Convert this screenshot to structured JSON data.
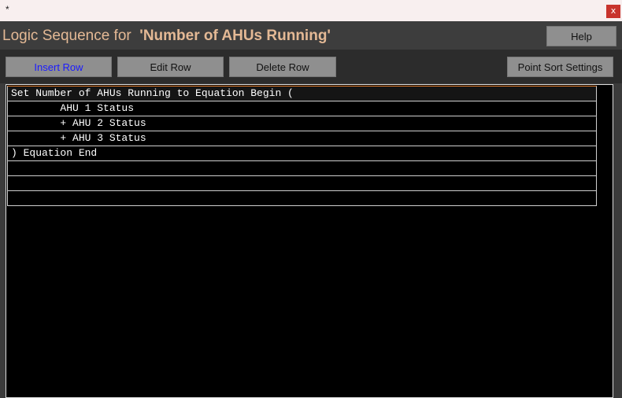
{
  "window": {
    "marker": "*",
    "close_label": "x"
  },
  "header": {
    "prefix": "Logic Sequence for ",
    "name": "'Number of AHUs Running'",
    "help_label": "Help"
  },
  "toolbar": {
    "insert_label": "Insert Row",
    "edit_label": "Edit Row",
    "delete_label": "Delete Row",
    "sort_label": "Point Sort Settings"
  },
  "colors": {
    "accent_title": "#e4b995",
    "insert_text": "#1a1aff",
    "selection_border": "#e07a2a"
  },
  "rows": [
    "Set Number of AHUs Running to Equation Begin (",
    "        AHU 1 Status",
    "        + AHU 2 Status",
    "        + AHU 3 Status",
    ") Equation End",
    "",
    "",
    ""
  ]
}
